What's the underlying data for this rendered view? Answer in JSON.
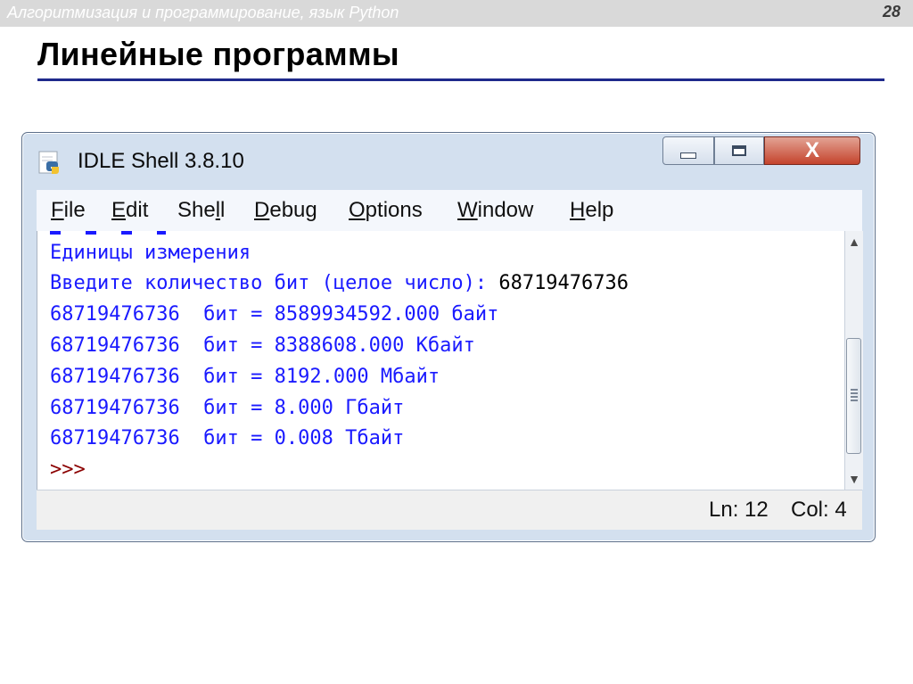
{
  "slide": {
    "course": "Алгоритмизация и программирование, язык Python",
    "page_number": "28",
    "title": "Линейные программы"
  },
  "window": {
    "title": "IDLE Shell 3.8.10",
    "app_icon": "python-idle-icon",
    "controls": {
      "minimize_icon": "minimize-icon",
      "maximize_icon": "maximize-icon",
      "close_label": "X"
    }
  },
  "menu": {
    "items": [
      {
        "label_u": "F",
        "label_rest": "ile"
      },
      {
        "label_u": "E",
        "label_rest": "dit"
      },
      {
        "label_pre": "She",
        "label_u": "l",
        "label_rest": "l"
      },
      {
        "label_u": "D",
        "label_rest": "ebug"
      },
      {
        "label_u": "O",
        "label_rest": "ptions"
      },
      {
        "label_u": "W",
        "label_rest": "indow"
      },
      {
        "label_u": "H",
        "label_rest": "elp"
      }
    ]
  },
  "shell": {
    "lines": [
      "Единицы измерения",
      "Введите количество бит (целое число): ",
      "68719476736  бит = 8589934592.000 байт",
      "68719476736  бит = 8388608.000 Кбайт",
      "68719476736  бит = 8192.000 Мбайт",
      "68719476736  бит = 8.000 Гбайт",
      "68719476736  бит = 0.008 Тбайт"
    ],
    "user_input": "68719476736",
    "prompt": ">>>"
  },
  "status": {
    "line": "Ln: 12",
    "col": "Col: 4"
  },
  "colors": {
    "output": "#1a1aff",
    "prompt": "#8b0000",
    "title_rule": "#1f2a8c"
  }
}
